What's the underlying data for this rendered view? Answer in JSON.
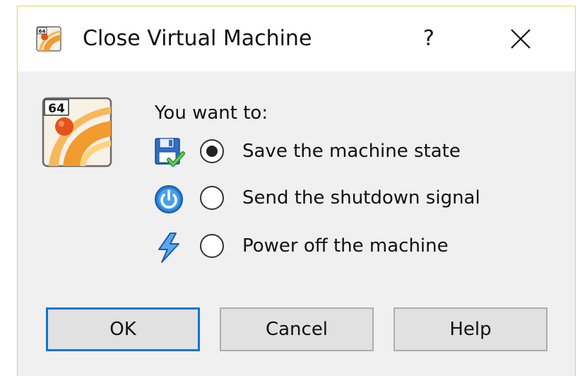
{
  "window": {
    "title": "Close Virtual Machine",
    "help_label": "?",
    "app_icon_badge": "64"
  },
  "body": {
    "vm_icon_badge": "64",
    "prompt": "You want to:"
  },
  "options": [
    {
      "icon": "save-state-icon",
      "label": "Save the machine state",
      "selected": true
    },
    {
      "icon": "power-button-icon",
      "label": "Send the shutdown signal",
      "selected": false
    },
    {
      "icon": "lightning-icon",
      "label": "Power off the machine",
      "selected": false
    }
  ],
  "buttons": {
    "ok": "OK",
    "cancel": "Cancel",
    "help": "Help"
  },
  "colors": {
    "accent": "#0078d7",
    "window_border": "#e2d64a",
    "dialog_bg": "#f0f0f0"
  }
}
